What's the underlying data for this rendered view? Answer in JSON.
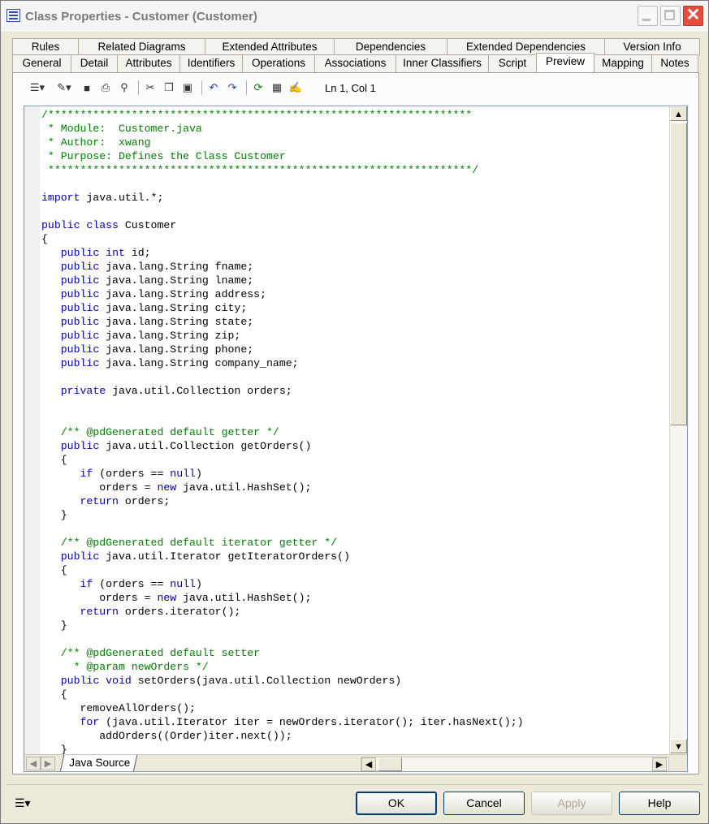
{
  "window": {
    "title": "Class Properties - Customer (Customer)"
  },
  "tabs": {
    "row1": [
      "Rules",
      "Related Diagrams",
      "Extended Attributes",
      "Dependencies",
      "Extended Dependencies",
      "Version Info"
    ],
    "row2": [
      "General",
      "Detail",
      "Attributes",
      "Identifiers",
      "Operations",
      "Associations",
      "Inner Classifiers",
      "Script",
      "Preview",
      "Mapping",
      "Notes"
    ],
    "active": "Preview"
  },
  "toolbar": {
    "icons": [
      "properties-menu-icon",
      "edit-menu-icon",
      "save-icon",
      "print-icon",
      "find-icon",
      "cut-icon",
      "copy-icon",
      "paste-icon",
      "undo-icon",
      "redo-icon",
      "refresh-icon",
      "grid-icon",
      "edit-properties-icon"
    ],
    "position": "Ln 1, Col 1"
  },
  "editor": {
    "sheet_tab": "Java Source",
    "lines": [
      "/******************************************************************",
      " * Module:  Customer.java",
      " * Author:  xwang",
      " * Purpose: Defines the Class Customer",
      " ******************************************************************/",
      "",
      "import java.util.*;",
      "",
      "public class Customer",
      "{",
      "   public int id;",
      "   public java.lang.String fname;",
      "   public java.lang.String lname;",
      "   public java.lang.String address;",
      "   public java.lang.String city;",
      "   public java.lang.String state;",
      "   public java.lang.String zip;",
      "   public java.lang.String phone;",
      "   public java.lang.String company_name;",
      "",
      "   private java.util.Collection orders;",
      "",
      "",
      "   /** @pdGenerated default getter */",
      "   public java.util.Collection getOrders()",
      "   {",
      "      if (orders == null)",
      "         orders = new java.util.HashSet();",
      "      return orders;",
      "   }",
      "",
      "   /** @pdGenerated default iterator getter */",
      "   public java.util.Iterator getIteratorOrders()",
      "   {",
      "      if (orders == null)",
      "         orders = new java.util.HashSet();",
      "      return orders.iterator();",
      "   }",
      "",
      "   /** @pdGenerated default setter",
      "     * @param newOrders */",
      "   public void setOrders(java.util.Collection newOrders)",
      "   {",
      "      removeAllOrders();",
      "      for (java.util.Iterator iter = newOrders.iterator(); iter.hasNext();)",
      "         addOrders((Order)iter.next());",
      "   }"
    ]
  },
  "buttons": {
    "ok": "OK",
    "cancel": "Cancel",
    "apply": "Apply",
    "help": "Help"
  }
}
